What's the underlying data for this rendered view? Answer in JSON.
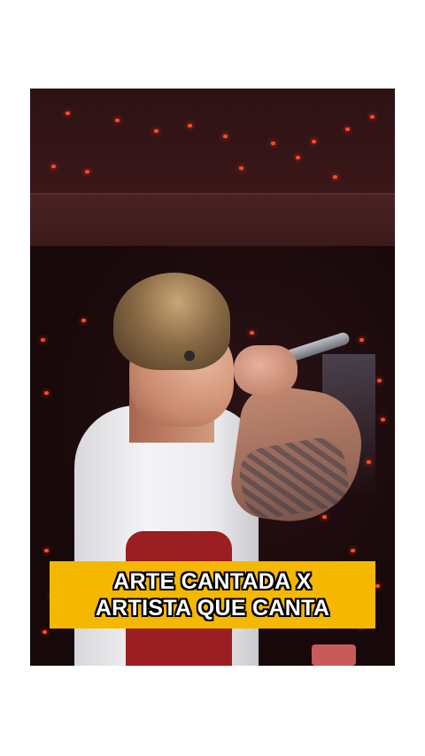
{
  "caption": {
    "line1": "ARTE CANTADA X",
    "line2": "ARTISTA QUE CANTA"
  },
  "colors": {
    "page_background": "#ffffff",
    "caption_background": "#f5b800",
    "caption_text": "#ffffff",
    "caption_outline": "#000000",
    "venue_lights": "#ff4a2a"
  },
  "video": {
    "subject": "singer-with-microphone"
  }
}
